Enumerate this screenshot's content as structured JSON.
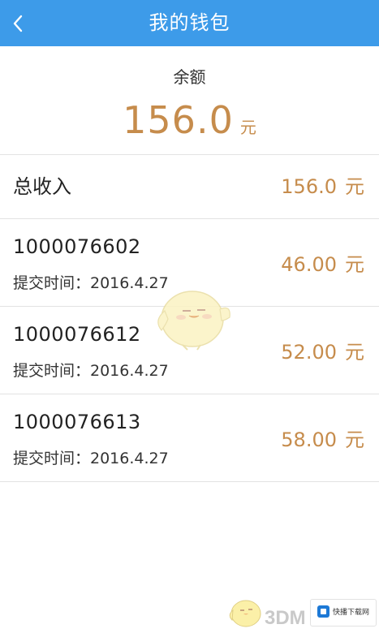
{
  "header": {
    "title": "我的钱包",
    "back_icon": "chevron-left-icon"
  },
  "balance": {
    "label": "余额",
    "amount": "156.0",
    "unit": "元"
  },
  "total_income": {
    "label": "总收入",
    "amount": "156.0",
    "unit": "元"
  },
  "records": [
    {
      "id": "1000076602",
      "time": "提交时间：2016.4.27",
      "amount": "46.00",
      "unit": "元"
    },
    {
      "id": "1000076612",
      "time": "提交时间：2016.4.27",
      "amount": "52.00",
      "unit": "元"
    },
    {
      "id": "1000076613",
      "time": "提交时间：2016.4.27",
      "amount": "58.00",
      "unit": "元"
    }
  ],
  "watermark": {
    "text": "3DM",
    "badge": "快播下载网"
  },
  "colors": {
    "header_bg": "#3d9be9",
    "amount": "#c68c4c",
    "divider": "#e3e3e3"
  }
}
